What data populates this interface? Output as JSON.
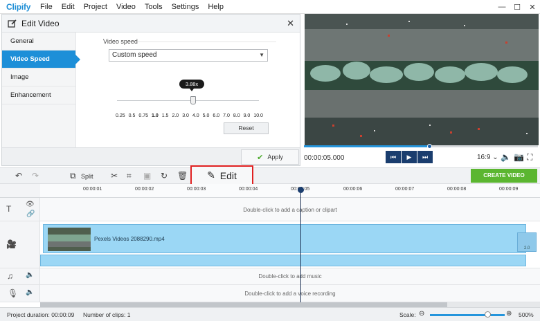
{
  "app": {
    "logo": "Clipify",
    "menu": [
      "File",
      "Edit",
      "Project",
      "Video",
      "Tools",
      "Settings",
      "Help"
    ],
    "window_controls": [
      "—",
      "☐",
      "✕"
    ]
  },
  "edit_panel": {
    "title": "Edit Video",
    "tabs": [
      {
        "label": "General",
        "active": false
      },
      {
        "label": "Video Speed",
        "active": true
      },
      {
        "label": "Image",
        "active": false
      },
      {
        "label": "Enhancement",
        "active": false
      }
    ],
    "speed_label": "Video speed",
    "speed_select_value": "Custom speed",
    "speed_value": "3.88x",
    "speed_ticks": [
      "0.25",
      "0.5",
      "0.75",
      "1.0",
      "1.5",
      "2.0",
      "3.0",
      "4.0",
      "5.0",
      "6.0",
      "7.0",
      "8.0",
      "9.0",
      "10.0"
    ],
    "reset_label": "Reset",
    "apply_label": "Apply"
  },
  "player": {
    "time": "00:00:05.000",
    "aspect": "16:9",
    "progress_fraction": 0.54
  },
  "toolbar": {
    "split_label": "Split",
    "edit_label": "Edit",
    "create_label": "CREATE VIDEO"
  },
  "timeline": {
    "timecodes": [
      "00:00:01",
      "00:00:02",
      "00:00:03",
      "00:00:04",
      "00:00:05",
      "00:00:06",
      "00:00:07",
      "00:00:08",
      "00:00:09"
    ],
    "caption_hint": "Double-click to add a caption or clipart",
    "clip_name": "Pexels Videos 2088290.mp4",
    "clip_end_label": "2.0",
    "music_hint": "Double-click to add music",
    "voice_hint": "Double-click to add a voice recording"
  },
  "status": {
    "duration": "Project duration:  00:00:09",
    "clips": "Number of clips: 1",
    "scale_label": "Scale:",
    "zoom": "500%"
  },
  "colors": {
    "accent": "#1d8fd8",
    "create_green": "#5bb630",
    "clip_blue": "#9bd7f5",
    "highlight_red": "#e02020"
  }
}
